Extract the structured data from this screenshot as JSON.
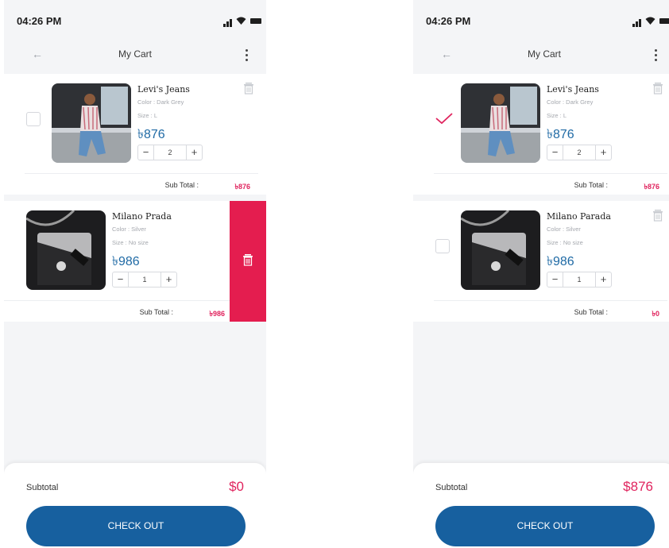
{
  "screens": [
    {
      "status": {
        "time": "04:26 PM"
      },
      "header": {
        "back_icon": "arrow-left-icon",
        "title": "My Cart",
        "menu_icon": "more-vertical-icon"
      },
      "items": [
        {
          "name": "Levi's Jeans",
          "color": "Color : Dark Grey",
          "size": "Size : L",
          "price": "৳876",
          "qty": "2",
          "sub_label": "Sub Total :",
          "sub_value": "৳876",
          "checked": false,
          "swiped": false
        },
        {
          "name": "Milano Prada",
          "color": "Color : Silver",
          "size": "Size : No size",
          "price": "৳986",
          "qty": "1",
          "sub_label": "Sub Total :",
          "sub_value": "৳986",
          "checked": false,
          "swiped": true
        }
      ],
      "footer": {
        "subtotal_label": "Subtotal",
        "subtotal_value": "$0",
        "checkout_label": "CHECK OUT"
      }
    },
    {
      "status": {
        "time": "04:26 PM"
      },
      "header": {
        "back_icon": "arrow-left-icon",
        "title": "My Cart",
        "menu_icon": "more-vertical-icon"
      },
      "items": [
        {
          "name": "Levi's Jeans",
          "color": "Color : Dark Grey",
          "size": "Size : L",
          "price": "৳876",
          "qty": "2",
          "sub_label": "Sub Total :",
          "sub_value": "৳876",
          "checked": true,
          "swiped": false
        },
        {
          "name": "Milano Parada",
          "color": "Color : Silver",
          "size": "Size : No size",
          "price": "৳986",
          "qty": "1",
          "sub_label": "Sub Total :",
          "sub_value": "৳0",
          "checked": false,
          "swiped": false
        }
      ],
      "footer": {
        "subtotal_label": "Subtotal",
        "subtotal_value": "$876",
        "checkout_label": "CHECK OUT"
      }
    }
  ],
  "colors": {
    "accent": "#e0245e",
    "price": "#1f6aa5",
    "primary_button": "#17609f",
    "delete": "#e41d4f"
  }
}
